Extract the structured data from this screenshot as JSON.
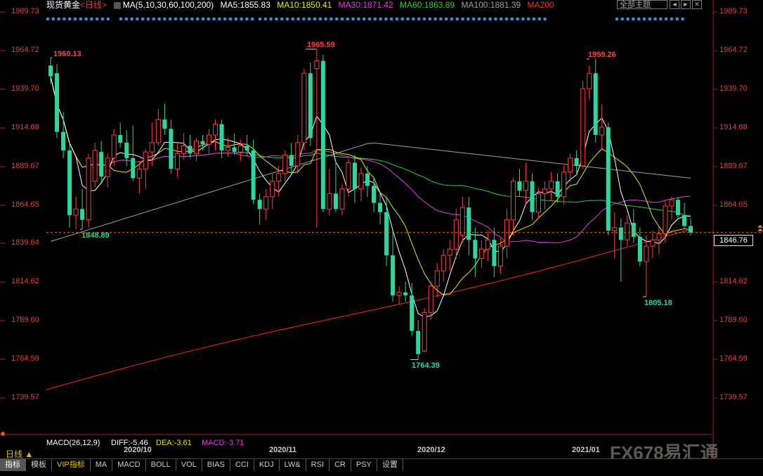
{
  "header": {
    "title": "现货黄金",
    "period": "<日线>",
    "ma_params": "MA(5,10,30,60,100,200)",
    "ma5": "MA5:1855.83",
    "ma10": "MA10:1850.41",
    "ma30": "MA30:1871.42",
    "ma60": "MA60:1863.89",
    "ma100": "MA100:1881.39",
    "ma200": "MA200",
    "theme_label": "全部主题",
    "theme_ctrl_1": "◄",
    "theme_ctrl_2": "►",
    "theme_ctrl_3": "✕"
  },
  "colors": {
    "up": "#ff3d3d",
    "down": "#2bd6a0",
    "ma5": "#ffffff",
    "ma10": "#e8e800",
    "ma30": "#e040e0",
    "ma60": "#30d030",
    "ma100": "#a0a0a0",
    "ma200": "#ff2020",
    "axis": "#e04040"
  },
  "y_axis_ticks": [
    "1989.73",
    "1964.72",
    "1939.70",
    "1914.68",
    "1889.67",
    "1864.65",
    "1839.64",
    "1814.62",
    "1789.60",
    "1764.59",
    "1739.57"
  ],
  "current_price": "1846.76",
  "annotations": {
    "a1": "1960.13",
    "a2": "1965.59",
    "a3": "1959.26",
    "a4": "1848.89",
    "a5": "1764.39",
    "a6": "1805.18"
  },
  "x_labels": [
    "2020/10",
    "2020/11",
    "2020/12",
    "2021/01"
  ],
  "macd": {
    "params": "MACD(26,12,9)",
    "diff": "DIFF:-5.46",
    "dea": "DEA:-3.61",
    "macd": "MACD:-3.71"
  },
  "period_label": "日线 ▲",
  "tabs": [
    "指标",
    "模板",
    "VIP指标",
    "MA",
    "MACD",
    "BOLL",
    "VOL",
    "BIAS",
    "CCI",
    "KDJ",
    "LW&",
    "RSI",
    "CR",
    "PSY",
    "设置"
  ],
  "watermark": "FX678易汇通",
  "chart_data": {
    "type": "candlestick",
    "title": "现货黄金",
    "ylim": [
      1730,
      1990
    ],
    "candles": [
      {
        "o": 1955,
        "h": 1960.13,
        "l": 1943,
        "c": 1948
      },
      {
        "o": 1950,
        "h": 1956,
        "l": 1908,
        "c": 1912
      },
      {
        "o": 1912,
        "h": 1925,
        "l": 1895,
        "c": 1900
      },
      {
        "o": 1900,
        "h": 1905,
        "l": 1850,
        "c": 1858
      },
      {
        "o": 1858,
        "h": 1870,
        "l": 1849,
        "c": 1862
      },
      {
        "o": 1862,
        "h": 1875,
        "l": 1848.89,
        "c": 1855
      },
      {
        "o": 1855,
        "h": 1898,
        "l": 1850,
        "c": 1895
      },
      {
        "o": 1880,
        "h": 1905,
        "l": 1876,
        "c": 1900
      },
      {
        "o": 1899,
        "h": 1906,
        "l": 1879,
        "c": 1883
      },
      {
        "o": 1883,
        "h": 1898,
        "l": 1876,
        "c": 1895
      },
      {
        "o": 1895,
        "h": 1914,
        "l": 1890,
        "c": 1910
      },
      {
        "o": 1910,
        "h": 1918,
        "l": 1902,
        "c": 1905
      },
      {
        "o": 1905,
        "h": 1913,
        "l": 1890,
        "c": 1895
      },
      {
        "o": 1895,
        "h": 1916,
        "l": 1880,
        "c": 1882
      },
      {
        "o": 1882,
        "h": 1893,
        "l": 1872,
        "c": 1888
      },
      {
        "o": 1888,
        "h": 1901,
        "l": 1875,
        "c": 1899
      },
      {
        "o": 1899,
        "h": 1918,
        "l": 1890,
        "c": 1905
      },
      {
        "o": 1905,
        "h": 1927,
        "l": 1903,
        "c": 1920
      },
      {
        "o": 1920,
        "h": 1930,
        "l": 1910,
        "c": 1914
      },
      {
        "o": 1914,
        "h": 1920,
        "l": 1885,
        "c": 1888
      },
      {
        "o": 1888,
        "h": 1905,
        "l": 1883,
        "c": 1898
      },
      {
        "o": 1898,
        "h": 1911,
        "l": 1894,
        "c": 1903
      },
      {
        "o": 1903,
        "h": 1910,
        "l": 1895,
        "c": 1898
      },
      {
        "o": 1898,
        "h": 1908,
        "l": 1893,
        "c": 1906
      },
      {
        "o": 1906,
        "h": 1910,
        "l": 1900,
        "c": 1904
      },
      {
        "o": 1904,
        "h": 1914,
        "l": 1898,
        "c": 1910
      },
      {
        "o": 1910,
        "h": 1920,
        "l": 1900,
        "c": 1917
      },
      {
        "o": 1917,
        "h": 1920,
        "l": 1895,
        "c": 1900
      },
      {
        "o": 1900,
        "h": 1908,
        "l": 1896,
        "c": 1902
      },
      {
        "o": 1902,
        "h": 1911,
        "l": 1897,
        "c": 1899
      },
      {
        "o": 1899,
        "h": 1907,
        "l": 1893,
        "c": 1903
      },
      {
        "o": 1903,
        "h": 1910,
        "l": 1896,
        "c": 1900
      },
      {
        "o": 1900,
        "h": 1907,
        "l": 1865,
        "c": 1868
      },
      {
        "o": 1868,
        "h": 1872,
        "l": 1852,
        "c": 1862
      },
      {
        "o": 1862,
        "h": 1875,
        "l": 1855,
        "c": 1870
      },
      {
        "o": 1870,
        "h": 1885,
        "l": 1862,
        "c": 1880
      },
      {
        "o": 1880,
        "h": 1890,
        "l": 1870,
        "c": 1885
      },
      {
        "o": 1885,
        "h": 1900,
        "l": 1880,
        "c": 1897
      },
      {
        "o": 1897,
        "h": 1905,
        "l": 1885,
        "c": 1890
      },
      {
        "o": 1890,
        "h": 1910,
        "l": 1885,
        "c": 1905
      },
      {
        "o": 1905,
        "h": 1953,
        "l": 1900,
        "c": 1950
      },
      {
        "o": 1950,
        "h": 1957,
        "l": 1903,
        "c": 1908
      },
      {
        "o": 1953,
        "h": 1965.59,
        "l": 1850,
        "c": 1958
      },
      {
        "o": 1958,
        "h": 1962,
        "l": 1860,
        "c": 1862
      },
      {
        "o": 1862,
        "h": 1888,
        "l": 1858,
        "c": 1872
      },
      {
        "o": 1872,
        "h": 1893,
        "l": 1860,
        "c": 1862
      },
      {
        "o": 1862,
        "h": 1878,
        "l": 1858,
        "c": 1875
      },
      {
        "o": 1875,
        "h": 1895,
        "l": 1870,
        "c": 1892
      },
      {
        "o": 1892,
        "h": 1897,
        "l": 1866,
        "c": 1875
      },
      {
        "o": 1875,
        "h": 1889,
        "l": 1867,
        "c": 1885
      },
      {
        "o": 1885,
        "h": 1890,
        "l": 1870,
        "c": 1877
      },
      {
        "o": 1877,
        "h": 1883,
        "l": 1860,
        "c": 1866
      },
      {
        "o": 1866,
        "h": 1872,
        "l": 1852,
        "c": 1860
      },
      {
        "o": 1860,
        "h": 1870,
        "l": 1825,
        "c": 1832
      },
      {
        "o": 1832,
        "h": 1848,
        "l": 1802,
        "c": 1806
      },
      {
        "o": 1806,
        "h": 1812,
        "l": 1800,
        "c": 1808
      },
      {
        "o": 1808,
        "h": 1815,
        "l": 1802,
        "c": 1806
      },
      {
        "o": 1806,
        "h": 1814,
        "l": 1780,
        "c": 1783
      },
      {
        "o": 1783,
        "h": 1790,
        "l": 1764.39,
        "c": 1768
      },
      {
        "o": 1770,
        "h": 1798,
        "l": 1769,
        "c": 1795
      },
      {
        "o": 1795,
        "h": 1815,
        "l": 1790,
        "c": 1812
      },
      {
        "o": 1812,
        "h": 1827,
        "l": 1805,
        "c": 1822
      },
      {
        "o": 1822,
        "h": 1836,
        "l": 1815,
        "c": 1832
      },
      {
        "o": 1832,
        "h": 1842,
        "l": 1822,
        "c": 1836
      },
      {
        "o": 1836,
        "h": 1862,
        "l": 1830,
        "c": 1855
      },
      {
        "o": 1845,
        "h": 1870,
        "l": 1840,
        "c": 1863
      },
      {
        "o": 1863,
        "h": 1870,
        "l": 1832,
        "c": 1842
      },
      {
        "o": 1842,
        "h": 1850,
        "l": 1818,
        "c": 1830
      },
      {
        "o": 1830,
        "h": 1842,
        "l": 1824,
        "c": 1836
      },
      {
        "o": 1836,
        "h": 1848,
        "l": 1828,
        "c": 1842
      },
      {
        "o": 1842,
        "h": 1850,
        "l": 1818,
        "c": 1825
      },
      {
        "o": 1825,
        "h": 1843,
        "l": 1820,
        "c": 1838
      },
      {
        "o": 1838,
        "h": 1862,
        "l": 1830,
        "c": 1855
      },
      {
        "o": 1855,
        "h": 1882,
        "l": 1845,
        "c": 1880
      },
      {
        "o": 1880,
        "h": 1888,
        "l": 1870,
        "c": 1874
      },
      {
        "o": 1874,
        "h": 1892,
        "l": 1865,
        "c": 1880
      },
      {
        "o": 1880,
        "h": 1885,
        "l": 1855,
        "c": 1860
      },
      {
        "o": 1860,
        "h": 1876,
        "l": 1856,
        "c": 1872
      },
      {
        "o": 1872,
        "h": 1880,
        "l": 1862,
        "c": 1875
      },
      {
        "o": 1875,
        "h": 1886,
        "l": 1868,
        "c": 1880
      },
      {
        "o": 1880,
        "h": 1885,
        "l": 1866,
        "c": 1870
      },
      {
        "o": 1870,
        "h": 1890,
        "l": 1865,
        "c": 1886
      },
      {
        "o": 1886,
        "h": 1898,
        "l": 1880,
        "c": 1895
      },
      {
        "o": 1895,
        "h": 1900,
        "l": 1885,
        "c": 1890
      },
      {
        "o": 1890,
        "h": 1945,
        "l": 1888,
        "c": 1940
      },
      {
        "o": 1940,
        "h": 1955,
        "l": 1933,
        "c": 1950
      },
      {
        "o": 1950,
        "h": 1959.26,
        "l": 1905,
        "c": 1910
      },
      {
        "o": 1910,
        "h": 1930,
        "l": 1900,
        "c": 1915
      },
      {
        "o": 1915,
        "h": 1918,
        "l": 1845,
        "c": 1848
      },
      {
        "o": 1848,
        "h": 1860,
        "l": 1830,
        "c": 1850
      },
      {
        "o": 1850,
        "h": 1856,
        "l": 1815,
        "c": 1842
      },
      {
        "o": 1842,
        "h": 1858,
        "l": 1838,
        "c": 1853
      },
      {
        "o": 1853,
        "h": 1862,
        "l": 1840,
        "c": 1844
      },
      {
        "o": 1844,
        "h": 1850,
        "l": 1825,
        "c": 1828
      },
      {
        "o": 1828,
        "h": 1845,
        "l": 1805.18,
        "c": 1838
      },
      {
        "o": 1838,
        "h": 1848,
        "l": 1830,
        "c": 1842
      },
      {
        "o": 1842,
        "h": 1850,
        "l": 1833,
        "c": 1846
      },
      {
        "o": 1846,
        "h": 1868,
        "l": 1840,
        "c": 1864
      },
      {
        "o": 1864,
        "h": 1870,
        "l": 1855,
        "c": 1868
      },
      {
        "o": 1868,
        "h": 1870,
        "l": 1855,
        "c": 1858
      },
      {
        "o": 1858,
        "h": 1866,
        "l": 1849,
        "c": 1851
      },
      {
        "o": 1851,
        "h": 1856,
        "l": 1845,
        "c": 1846.76
      }
    ]
  }
}
